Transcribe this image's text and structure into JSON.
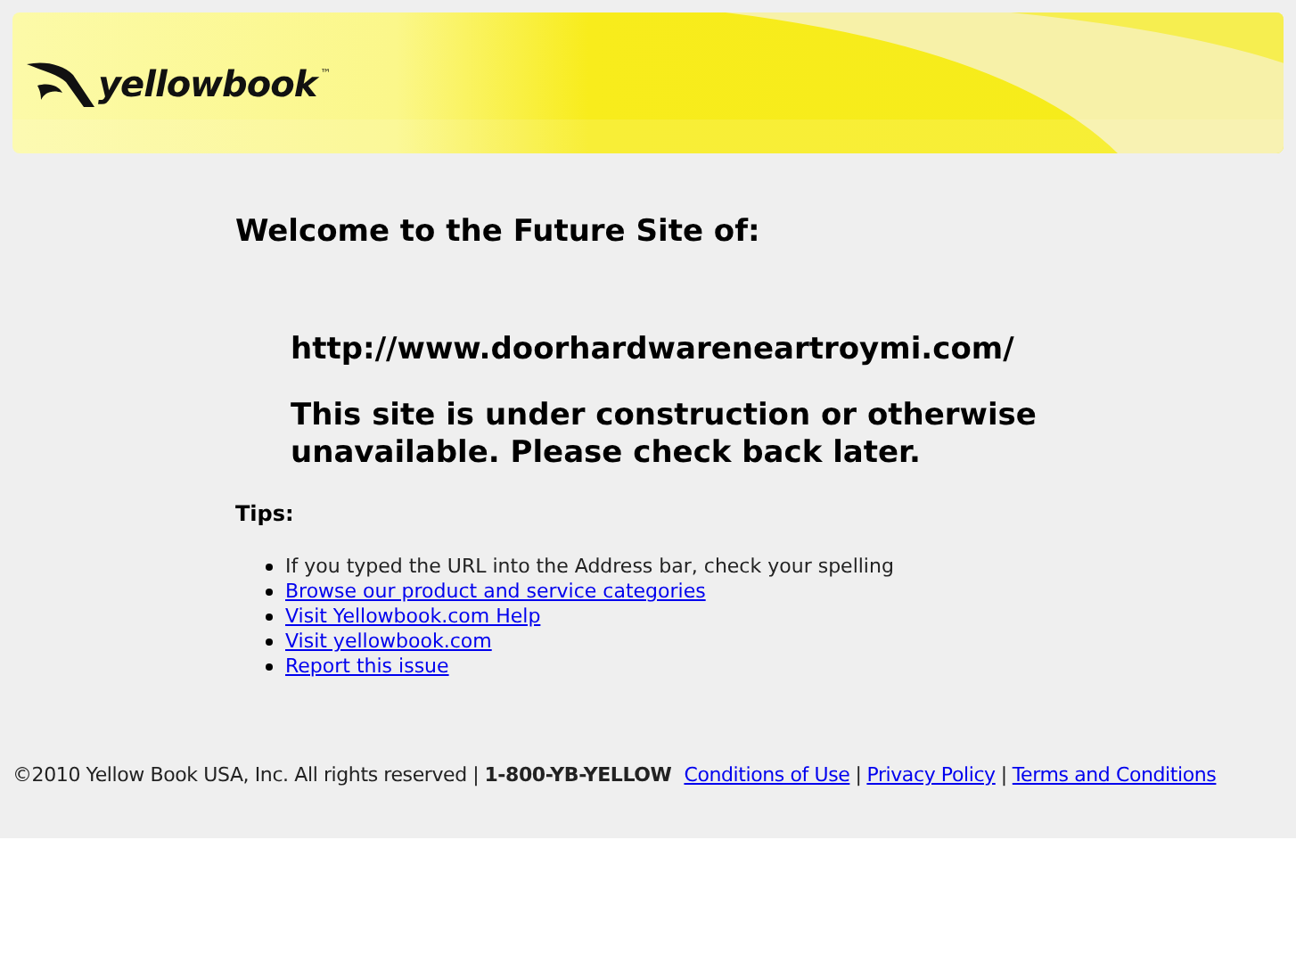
{
  "header": {
    "logo": {
      "text": "yellowbook",
      "mark": "™"
    }
  },
  "heading": "Welcome to the Future Site of:",
  "site_url": "http://www.doorhardwareneartroymi.com/",
  "message": "This site is under construction or otherwise unavailable. Please check back later.",
  "tips": {
    "title": "Tips:",
    "items": [
      {
        "kind": "text",
        "text": "If you typed the URL into the Address bar, check your spelling"
      },
      {
        "kind": "link",
        "text": "Browse our product and service categories"
      },
      {
        "kind": "link",
        "text": "Visit Yellowbook.com Help"
      },
      {
        "kind": "link",
        "text": "Visit yellowbook.com"
      },
      {
        "kind": "link",
        "text": "Report this issue"
      }
    ]
  },
  "footer": [
    {
      "kind": "text",
      "text": "©2010 Yellow Book USA, Inc. All rights reserved |"
    },
    {
      "kind": "bold",
      "text": "1-800-YB-YELLOW"
    },
    {
      "kind": "link",
      "text": "Conditions of Use"
    },
    {
      "kind": "text",
      "text": "|"
    },
    {
      "kind": "link",
      "text": "Privacy Policy"
    },
    {
      "kind": "text",
      "text": "|"
    },
    {
      "kind": "link",
      "text": "Terms and Conditions"
    }
  ]
}
